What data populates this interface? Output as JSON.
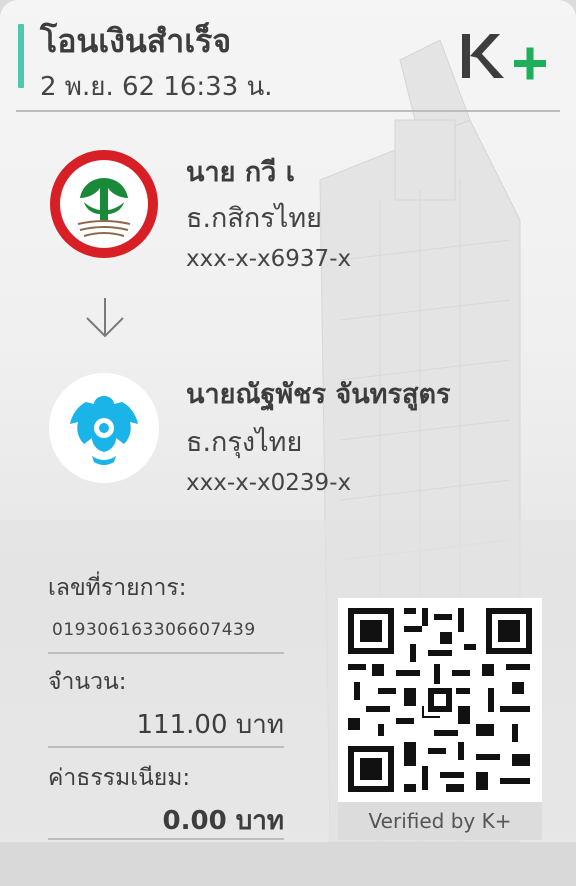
{
  "header": {
    "title": "โอนเงินสำเร็จ",
    "datetime": "2 พ.ย. 62  16:33 น."
  },
  "brand": {
    "logo_text": "K+",
    "accent_color": "#4fc8b0"
  },
  "sender": {
    "name": "นาย กวี เ",
    "bank": "ธ.กสิกรไทย",
    "account": "xxx-x-x6937-x",
    "bank_logo_icon": "kasikorn-bank-logo",
    "bank_color": "#1a8a3a"
  },
  "transfer_arrow_icon": "arrow-down-icon",
  "receiver": {
    "name": "นายณัฐพัชร จันทรสูตร",
    "bank": "ธ.กรุงไทย",
    "account": "xxx-x-x0239-x",
    "bank_logo_icon": "krungthai-bank-logo",
    "bank_color": "#1ab4e8"
  },
  "details": {
    "ref_label": "เลขที่รายการ:",
    "ref_value": "019306163306607439",
    "amount_label": "จำนวน:",
    "amount_value": "111.00 บาท",
    "fee_label": "ค่าธรรมเนียม:",
    "fee_value": "0.00 บาท"
  },
  "qr": {
    "caption": "Verified by K+"
  }
}
